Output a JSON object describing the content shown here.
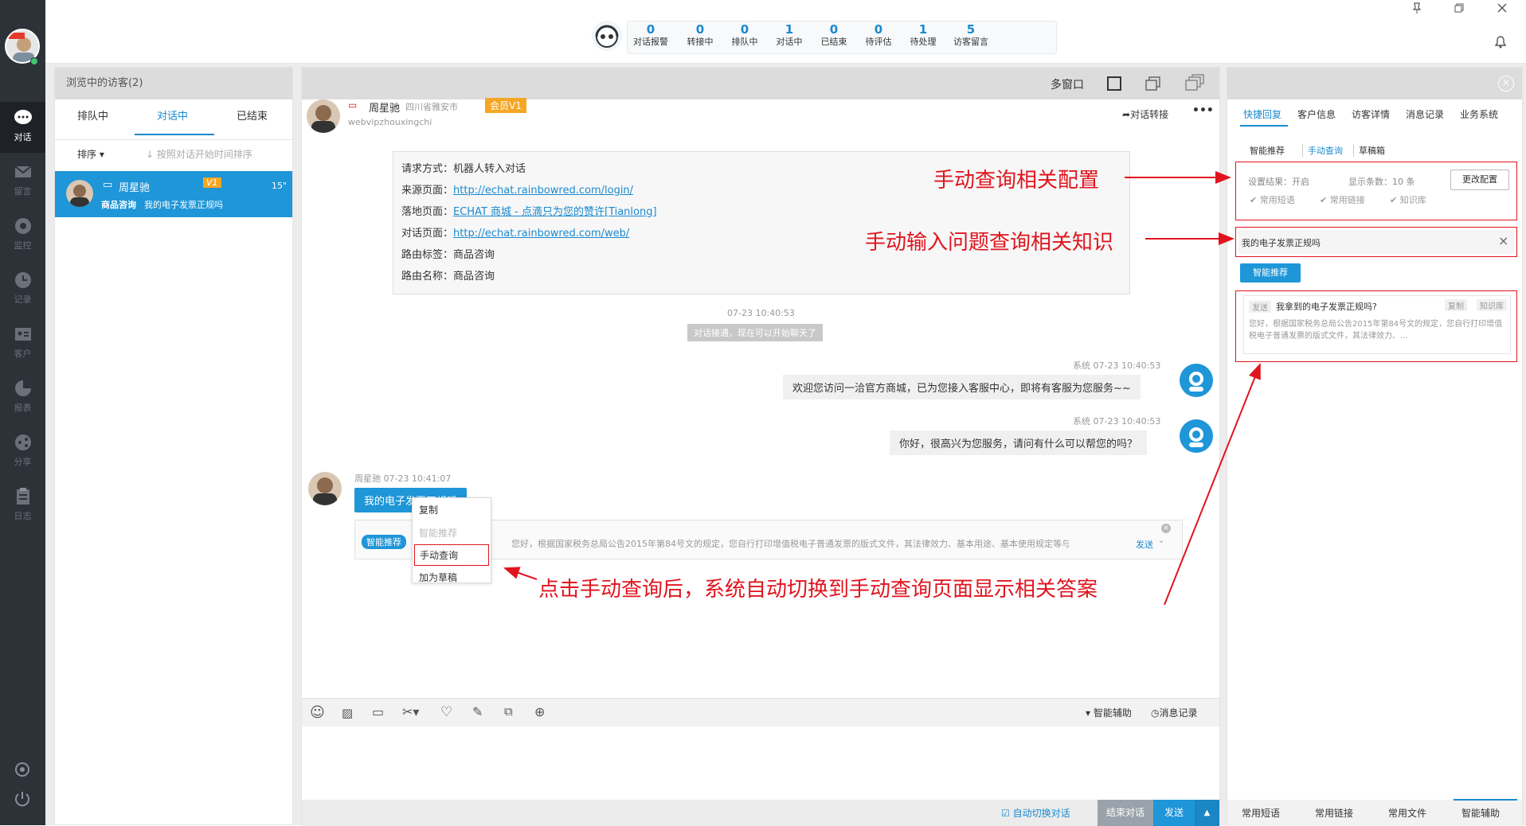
{
  "nav": {
    "items": [
      {
        "label": "对话",
        "icon": "chat-icon"
      },
      {
        "label": "留言",
        "icon": "mail-icon"
      },
      {
        "label": "监控",
        "icon": "eye-icon"
      },
      {
        "label": "记录",
        "icon": "clock-icon"
      },
      {
        "label": "客户",
        "icon": "id-card-icon"
      },
      {
        "label": "报表",
        "icon": "pie-chart-icon"
      },
      {
        "label": "分享",
        "icon": "share-icon"
      },
      {
        "label": "日志",
        "icon": "clipboard-icon"
      }
    ]
  },
  "topbar": {
    "stats": [
      {
        "n": "0",
        "l": "对话报警"
      },
      {
        "n": "0",
        "l": "转接中"
      },
      {
        "n": "0",
        "l": "排队中"
      },
      {
        "n": "1",
        "l": "对话中"
      },
      {
        "n": "0",
        "l": "已结束"
      },
      {
        "n": "0",
        "l": "待评估"
      },
      {
        "n": "1",
        "l": "待处理"
      },
      {
        "n": "5",
        "l": "访客留言"
      }
    ]
  },
  "visitors": {
    "header": "浏览中的访客(2)",
    "tabs": [
      "排队中",
      "对话中",
      "已结束"
    ],
    "sort_label": "排序",
    "sort_hint": "按照对话开始时间排序",
    "item": {
      "name": "周星驰",
      "badge": "V1",
      "time": "15\"",
      "tag": "商品咨询",
      "msg": "我的电子发票正规吗"
    }
  },
  "chat": {
    "toolbar_label": "多窗口",
    "visitor_name": "周星驰",
    "visitor_location": "四川省雅安市",
    "visitor_id": "webvipzhouxingchi",
    "member_badge": "会员V1",
    "transfer_label": "对话转接",
    "info": [
      {
        "k": "请求方式：",
        "v": "机器人转入对话",
        "link": false
      },
      {
        "k": "来源页面：",
        "v": "http://echat.rainbowred.com/login/",
        "link": true
      },
      {
        "k": "落地页面：",
        "v": "ECHAT 商城 - 点滴只为您的赞许[Tianlong]",
        "link": true
      },
      {
        "k": "对话页面：",
        "v": "http://echat.rainbowred.com/web/",
        "link": true
      },
      {
        "k": "路由标签：",
        "v": "商品咨询",
        "link": false
      },
      {
        "k": "路由名称：",
        "v": "商品咨询",
        "link": false
      }
    ],
    "connect_time": "07-23 10:40:53",
    "connect_notice": "对话接通，现在可以开始聊天了",
    "sys1_meta": "系统 07-23 10:40:53",
    "sys1_text": "欢迎您访问一洽官方商城，已为您接入客服中心，即将有客服为您服务~~",
    "sys2_meta": "系统 07-23 10:40:53",
    "sys2_text": "你好，很高兴为您服务，请问有什么可以帮您的吗？",
    "visitor_meta": "周星驰 07-23 10:41:07",
    "visitor_text": "我的电子发票正规吗",
    "context_menu": [
      "复制",
      "智能推荐",
      "手动查询",
      "加为草稿"
    ],
    "smart_tag": "智能推荐",
    "smart_text": "您好，根据国家税务总局公告2015年第84号文的规定，您自行打印增值税电子普通发票的版式文件，其法律效力、基本用途、基本使用规定等与...",
    "smart_send": "发送",
    "bottom_assist": "智能辅助",
    "bottom_records": "消息记录",
    "auto_switch": "自动切换对话",
    "end_btn": "结束对话",
    "send_btn": "发送"
  },
  "right": {
    "tabs": [
      "快捷回复",
      "客户信息",
      "访客详情",
      "消息记录",
      "业务系统"
    ],
    "subtabs": [
      "智能推荐",
      "手动查询",
      "草稿箱"
    ],
    "setting_result_label": "设置结果：",
    "setting_result": "开启",
    "count_label": "显示条数：",
    "count": "10 条",
    "config_btn": "更改配置",
    "checks": [
      "常用短语",
      "常用链接",
      "知识库"
    ],
    "search_value": "我的电子发票正规吗",
    "smart_btn": "智能推荐",
    "result": {
      "send": "发送",
      "title": "我拿到的电子发票正规吗?",
      "copy": "复制",
      "kb": "知识库",
      "text": "您好，根据国家税务总局公告2015年第84号文的规定，您自行打印增值税电子普通发票的版式文件，其法律效力、..."
    },
    "bottom_tabs": [
      "常用短语",
      "常用链接",
      "常用文件",
      "智能辅助"
    ]
  },
  "annotations": {
    "a1": "手动查询相关配置",
    "a2": "手动输入问题查询相关知识",
    "a3": "点击手动查询后，系统自动切换到手动查询页面显示相关答案"
  }
}
